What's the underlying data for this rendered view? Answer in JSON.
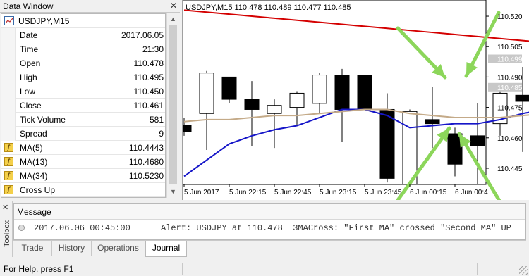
{
  "data_window": {
    "title": "Data Window",
    "symbol": "USDJPY,M15",
    "rows": [
      {
        "label": "Date",
        "value": "2017.06.05"
      },
      {
        "label": "Time",
        "value": "21:30"
      },
      {
        "label": "Open",
        "value": "110.478"
      },
      {
        "label": "High",
        "value": "110.495"
      },
      {
        "label": "Low",
        "value": "110.450"
      },
      {
        "label": "Close",
        "value": "110.461"
      },
      {
        "label": "Tick Volume",
        "value": "581"
      },
      {
        "label": "Spread",
        "value": "9"
      }
    ],
    "indicators": [
      {
        "label": "MA(5)",
        "value": "110.4443"
      },
      {
        "label": "MA(13)",
        "value": "110.4680"
      },
      {
        "label": "MA(34)",
        "value": "110.5230"
      },
      {
        "label": "Cross Up",
        "value": ""
      }
    ]
  },
  "chart": {
    "header": "USDJPY,M15  110.478 110.489 110.477 110.485",
    "price_ticks": [
      "110.520",
      "110.505",
      "110.490",
      "110.475",
      "110.460",
      "110.445"
    ],
    "price_badges": [
      "110.499",
      "110.485"
    ],
    "time_ticks": [
      "5 Jun 2017",
      "5 Jun 22:15",
      "5 Jun 22:45",
      "5 Jun 23:15",
      "5 Jun 23:45",
      "6 Jun 00:15",
      "6 Jun 00:4"
    ],
    "colors": {
      "ma_fast": "#1515c8",
      "ma_mid": "#c4aa88",
      "ma_slow": "#d40000",
      "arrows": "#8cd65a",
      "signal": "#e8d200"
    }
  },
  "chart_data": {
    "type": "candlestick",
    "symbol": "USDJPY",
    "timeframe": "M15",
    "ylim": [
      110.437,
      110.528
    ],
    "candles": [
      {
        "o": 110.466,
        "h": 110.47,
        "l": 110.461,
        "c": 110.463
      },
      {
        "o": 110.472,
        "h": 110.493,
        "l": 110.454,
        "c": 110.492
      },
      {
        "o": 110.49,
        "h": 110.49,
        "l": 110.477,
        "c": 110.479
      },
      {
        "o": 110.479,
        "h": 110.488,
        "l": 110.456,
        "c": 110.474
      },
      {
        "o": 110.472,
        "h": 110.479,
        "l": 110.455,
        "c": 110.476
      },
      {
        "o": 110.475,
        "h": 110.483,
        "l": 110.466,
        "c": 110.482
      },
      {
        "o": 110.477,
        "h": 110.492,
        "l": 110.472,
        "c": 110.491
      },
      {
        "o": 110.491,
        "h": 110.494,
        "l": 110.458,
        "c": 110.474
      },
      {
        "o": 110.491,
        "h": 110.491,
        "l": 110.475,
        "c": 110.474
      },
      {
        "o": 110.474,
        "h": 110.482,
        "l": 110.438,
        "c": 110.44
      },
      {
        "o": 110.437,
        "h": 110.474,
        "l": 110.437,
        "c": 110.473
      },
      {
        "o": 110.469,
        "h": 110.485,
        "l": 110.455,
        "c": 110.467
      },
      {
        "o": 110.462,
        "h": 110.465,
        "l": 110.441,
        "c": 110.447
      },
      {
        "o": 110.461,
        "h": 110.477,
        "l": 110.437,
        "c": 110.456
      },
      {
        "o": 110.467,
        "h": 110.487,
        "l": 110.461,
        "c": 110.482
      },
      {
        "o": 110.481,
        "h": 110.495,
        "l": 110.453,
        "c": 110.478
      },
      {
        "o": 110.478,
        "h": 110.489,
        "l": 110.477,
        "c": 110.485
      }
    ],
    "series": [
      {
        "color": "#1515c8",
        "values": [
          110.441,
          110.449,
          110.457,
          110.461,
          110.464,
          110.466,
          110.47,
          110.474,
          110.474,
          110.471,
          110.465,
          110.466,
          110.467,
          110.467,
          110.469,
          110.472,
          110.474
        ]
      },
      {
        "color": "#c4aa88",
        "values": [
          110.468,
          110.469,
          110.469,
          110.47,
          110.471,
          110.471,
          110.472,
          110.473,
          110.474,
          110.474,
          110.472,
          110.471,
          110.47,
          110.47,
          110.47,
          110.471,
          110.472
        ]
      },
      {
        "color": "#d40000",
        "values": [
          110.523,
          110.522,
          110.521,
          110.52,
          110.519,
          110.518,
          110.517,
          110.516,
          110.515,
          110.514,
          110.513,
          110.512,
          110.511,
          110.51,
          110.509,
          110.508,
          110.507
        ]
      }
    ],
    "signal_index": 16
  },
  "toolbox": {
    "label": "Toolbox",
    "message_header": "Message",
    "message": {
      "time": "2017.06.06 00:45:00",
      "text": "Alert: USDJPY at 110.478  3MACross: \"First MA\" crossed \"Second MA\" UP"
    },
    "tabs": [
      "Trade",
      "History",
      "Operations",
      "Journal"
    ],
    "active_tab": "Journal"
  },
  "status": {
    "text": "For Help, press F1"
  }
}
